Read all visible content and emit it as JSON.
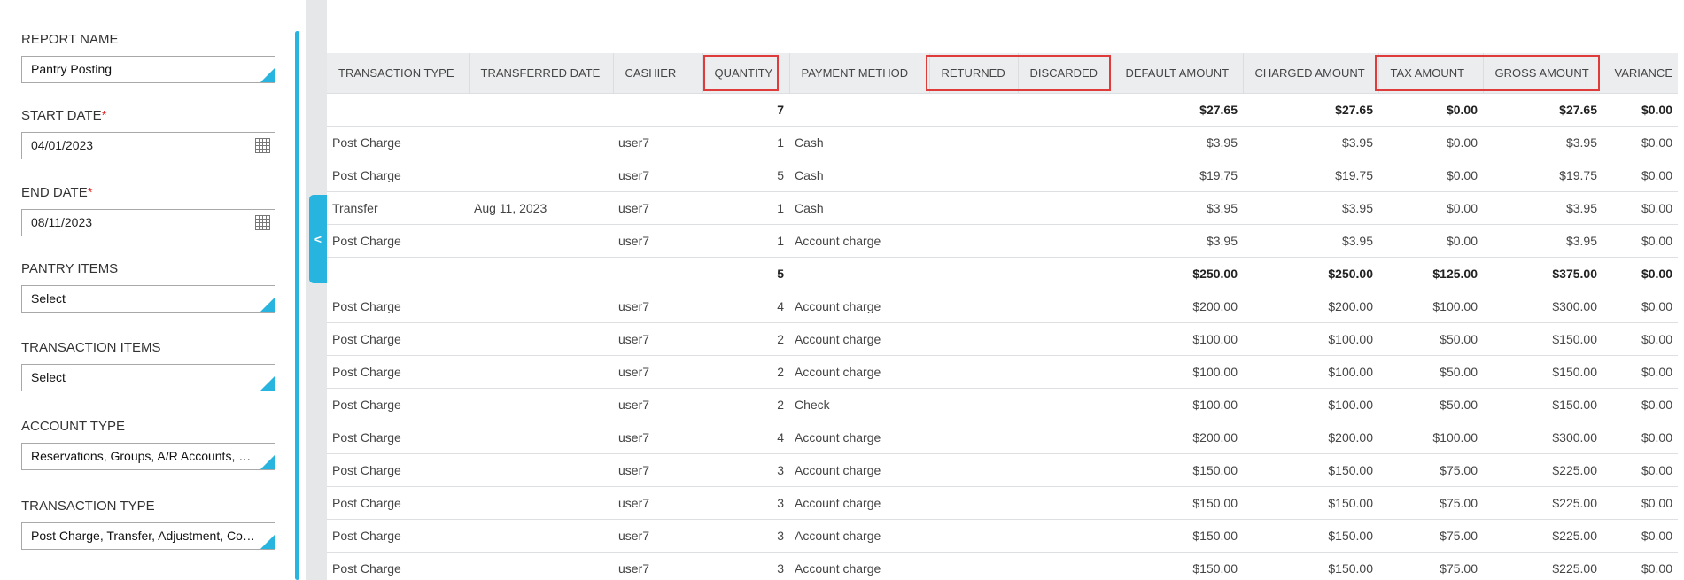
{
  "filters": {
    "report_name": {
      "label": "REPORT NAME",
      "value": "Pantry Posting"
    },
    "start_date": {
      "label": "START DATE",
      "required": "*",
      "value": "04/01/2023"
    },
    "end_date": {
      "label": "END DATE",
      "required": "*",
      "value": "08/11/2023"
    },
    "pantry_items": {
      "label": "PANTRY ITEMS",
      "value": "Select"
    },
    "transaction_items": {
      "label": "TRANSACTION ITEMS",
      "value": "Select"
    },
    "account_type": {
      "label": "ACCOUNT TYPE",
      "value": "Reservations, Groups, A/R Accounts, Hou..."
    },
    "transaction_type": {
      "label": "TRANSACTION TYPE",
      "value": "Post Charge, Transfer, Adjustment, Corre..."
    }
  },
  "toggle_label": "<",
  "accent_color": "#27b4de",
  "highlight_color": "#e03b3b",
  "columns": [
    "TRANSACTION TYPE",
    "TRANSFERRED DATE",
    "CASHIER",
    "QUANTITY",
    "PAYMENT METHOD",
    "RETURNED",
    "DISCARDED",
    "DEFAULT AMOUNT",
    "CHARGED AMOUNT",
    "TAX AMOUNT",
    "GROSS AMOUNT",
    "VARIANCE"
  ],
  "rows": [
    {
      "total": true,
      "cells": [
        "",
        "",
        "",
        "7",
        "",
        "",
        "",
        "$27.65",
        "$27.65",
        "$0.00",
        "$27.65",
        "$0.00"
      ]
    },
    {
      "total": false,
      "cells": [
        "Post Charge",
        "",
        "user7",
        "1",
        "Cash",
        "",
        "",
        "$3.95",
        "$3.95",
        "$0.00",
        "$3.95",
        "$0.00"
      ]
    },
    {
      "total": false,
      "cells": [
        "Post Charge",
        "",
        "user7",
        "5",
        "Cash",
        "",
        "",
        "$19.75",
        "$19.75",
        "$0.00",
        "$19.75",
        "$0.00"
      ]
    },
    {
      "total": false,
      "cells": [
        "Transfer",
        "Aug 11, 2023",
        "user7",
        "1",
        "Cash",
        "",
        "",
        "$3.95",
        "$3.95",
        "$0.00",
        "$3.95",
        "$0.00"
      ]
    },
    {
      "total": false,
      "cells": [
        "Post Charge",
        "",
        "user7",
        "1",
        "Account charge",
        "",
        "",
        "$3.95",
        "$3.95",
        "$0.00",
        "$3.95",
        "$0.00"
      ]
    },
    {
      "total": true,
      "cells": [
        "",
        "",
        "",
        "5",
        "",
        "",
        "",
        "$250.00",
        "$250.00",
        "$125.00",
        "$375.00",
        "$0.00"
      ]
    },
    {
      "total": false,
      "cells": [
        "Post Charge",
        "",
        "user7",
        "4",
        "Account charge",
        "",
        "",
        "$200.00",
        "$200.00",
        "$100.00",
        "$300.00",
        "$0.00"
      ]
    },
    {
      "total": false,
      "cells": [
        "Post Charge",
        "",
        "user7",
        "2",
        "Account charge",
        "",
        "",
        "$100.00",
        "$100.00",
        "$50.00",
        "$150.00",
        "$0.00"
      ]
    },
    {
      "total": false,
      "cells": [
        "Post Charge",
        "",
        "user7",
        "2",
        "Account charge",
        "",
        "",
        "$100.00",
        "$100.00",
        "$50.00",
        "$150.00",
        "$0.00"
      ]
    },
    {
      "total": false,
      "cells": [
        "Post Charge",
        "",
        "user7",
        "2",
        "Check",
        "",
        "",
        "$100.00",
        "$100.00",
        "$50.00",
        "$150.00",
        "$0.00"
      ]
    },
    {
      "total": false,
      "cells": [
        "Post Charge",
        "",
        "user7",
        "4",
        "Account charge",
        "",
        "",
        "$200.00",
        "$200.00",
        "$100.00",
        "$300.00",
        "$0.00"
      ]
    },
    {
      "total": false,
      "cells": [
        "Post Charge",
        "",
        "user7",
        "3",
        "Account charge",
        "",
        "",
        "$150.00",
        "$150.00",
        "$75.00",
        "$225.00",
        "$0.00"
      ]
    },
    {
      "total": false,
      "cells": [
        "Post Charge",
        "",
        "user7",
        "3",
        "Account charge",
        "",
        "",
        "$150.00",
        "$150.00",
        "$75.00",
        "$225.00",
        "$0.00"
      ]
    },
    {
      "total": false,
      "cells": [
        "Post Charge",
        "",
        "user7",
        "3",
        "Account charge",
        "",
        "",
        "$150.00",
        "$150.00",
        "$75.00",
        "$225.00",
        "$0.00"
      ]
    },
    {
      "total": false,
      "cells": [
        "Post Charge",
        "",
        "user7",
        "3",
        "Account charge",
        "",
        "",
        "$150.00",
        "$150.00",
        "$75.00",
        "$225.00",
        "$0.00"
      ]
    }
  ]
}
